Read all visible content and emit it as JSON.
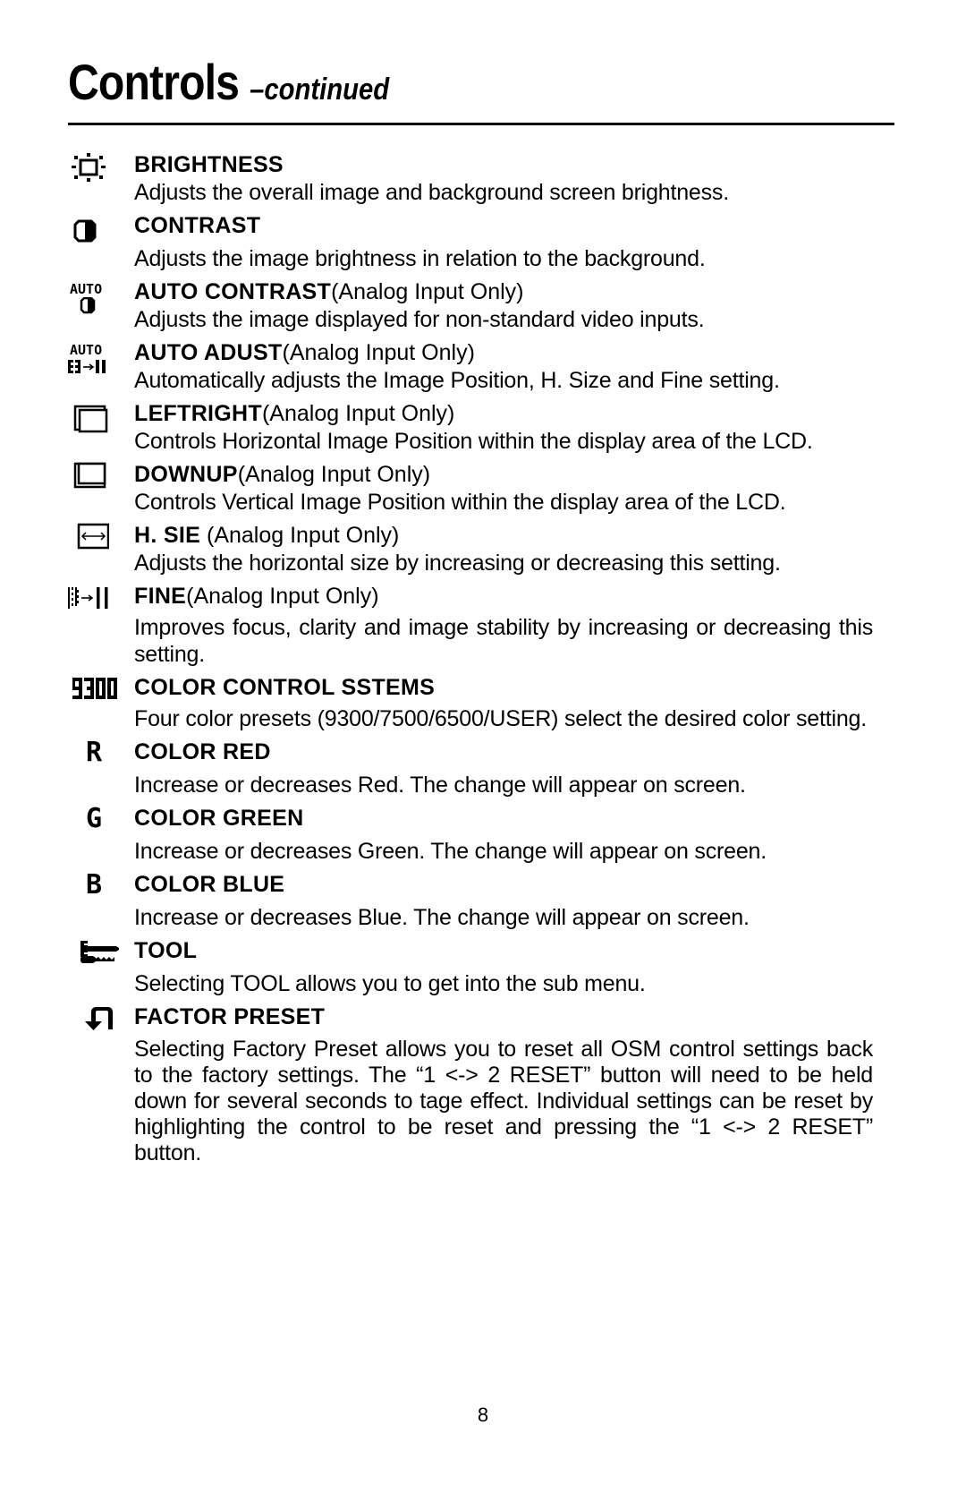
{
  "page": {
    "title": "Controls",
    "subtitle": "–continued",
    "page_number": "8"
  },
  "entries": [
    {
      "icon": "brightness-sun-icon",
      "name": "BRIGHTNESS",
      "qualifier": "",
      "description": "Adjusts the overall image and background screen brightness."
    },
    {
      "icon": "contrast-half-circle-icon",
      "name": "CONTRAST",
      "qualifier": "",
      "description": "Adjusts the image brightness in relation to the background."
    },
    {
      "icon": "auto-contrast-icon",
      "icon_text": "AUTO",
      "name": "AUTO CONTRAST",
      "qualifier": "(Analog Input Only)",
      "description": "Adjusts the image displayed for non-standard video inputs."
    },
    {
      "icon": "auto-adjust-icon",
      "icon_text": "AUTO",
      "name": "AUTO ADUST",
      "qualifier": "(Analog Input Only)",
      "description": "Automatically adjusts the Image Position, H. Size and Fine setting."
    },
    {
      "icon": "left-right-position-icon",
      "name": "LEFTRIGHT",
      "qualifier": "(Analog Input Only)",
      "description": "Controls Horizontal Image Position within the display area of the LCD."
    },
    {
      "icon": "down-up-position-icon",
      "name": "DOWNUP",
      "qualifier": "(Analog Input Only)",
      "description": "Controls Vertical Image Position within the display area of the LCD."
    },
    {
      "icon": "horizontal-size-icon",
      "name": "H. SIE",
      "qualifier": " (Analog Input Only)",
      "description": "Adjusts the horizontal size by increasing or decreasing this setting."
    },
    {
      "icon": "fine-icon",
      "name": "FINE",
      "qualifier": "(Analog Input Only)",
      "description": "Improves focus, clarity and image stability by increasing or decreasing this setting."
    },
    {
      "icon": "color-9300-icon",
      "icon_text": "9300",
      "name": "COLOR CONTROL SSTEMS",
      "qualifier": "",
      "description": "Four color presets (9300/7500/6500/USER) select the desired color setting."
    },
    {
      "icon": "color-red-icon",
      "icon_text": "R",
      "name": "COLOR RED",
      "qualifier": "",
      "description": "Increase or decreases Red. The change will appear on screen."
    },
    {
      "icon": "color-green-icon",
      "icon_text": "G",
      "name": "COLOR GREEN",
      "qualifier": "",
      "description": "Increase or decreases Green. The change will appear on screen."
    },
    {
      "icon": "color-blue-icon",
      "icon_text": "B",
      "name": "COLOR BLUE",
      "qualifier": "",
      "description": "Increase or decreases Blue. The change will appear on screen."
    },
    {
      "icon": "tool-wrench-screwdriver-icon",
      "name": "TOOL",
      "qualifier": "",
      "description": "Selecting TOOL allows you to get into the sub menu."
    },
    {
      "icon": "factory-preset-return-icon",
      "name": "FACTOR PRESET",
      "qualifier": "",
      "description": "Selecting Factory Preset allows you to reset all OSM control settings back to the factory settings. The “1 <-> 2 RESET” button will need to be held down for several seconds to tage effect. Individual settings can be reset by highlighting the control to be reset and pressing the “1 <-> 2 RESET” button."
    }
  ]
}
